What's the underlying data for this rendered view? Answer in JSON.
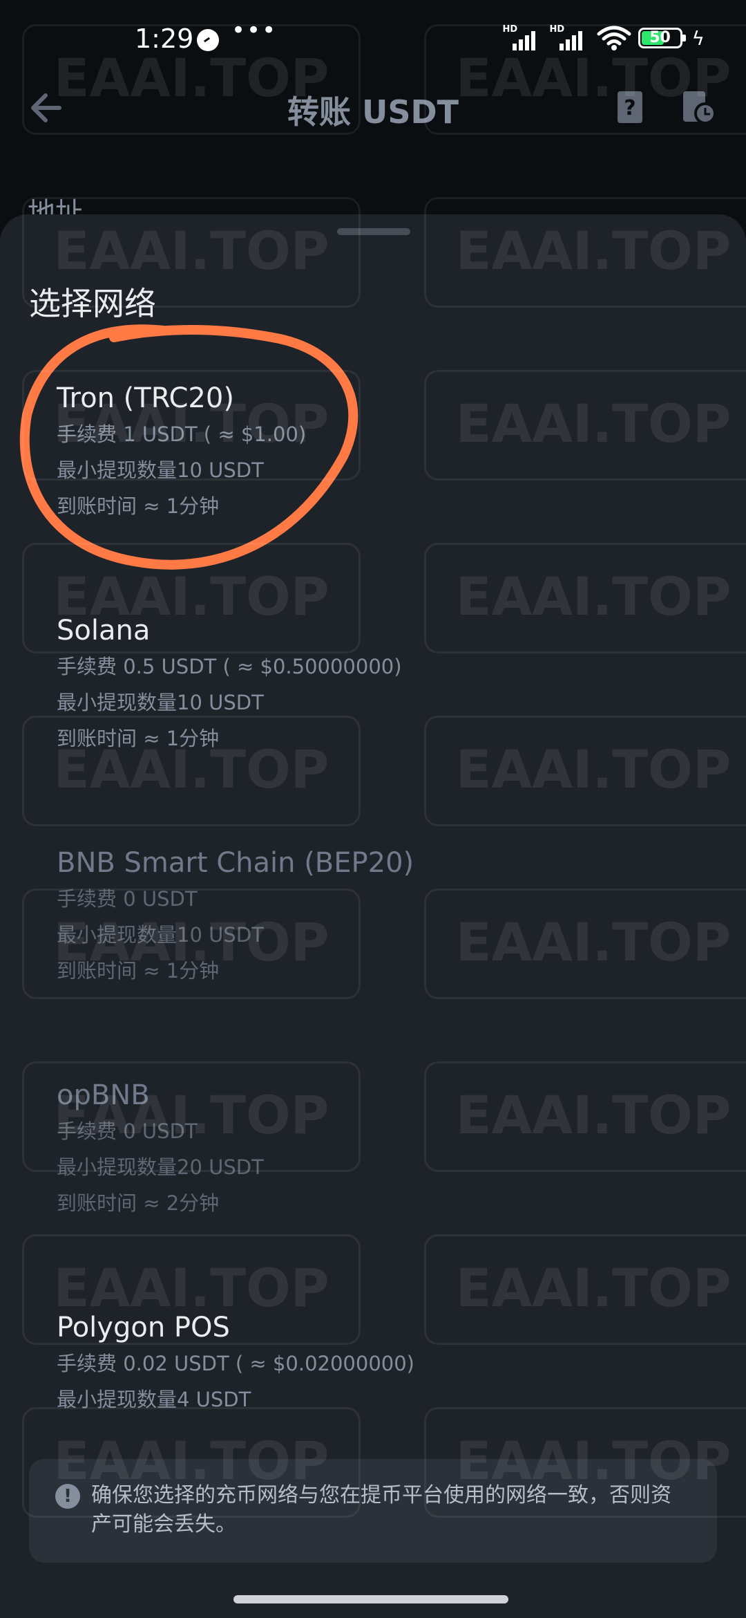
{
  "status_bar": {
    "time": "1:29",
    "dots": "•••",
    "signal_label": "HD",
    "battery": "50"
  },
  "header": {
    "title": "转账 USDT",
    "behind_label": "地址"
  },
  "sheet": {
    "title": "选择网络",
    "networks": [
      {
        "name": "Tron (TRC20)",
        "fee": "手续费 1 USDT ( ≈ $1.00)",
        "min": "最小提现数量10 USDT",
        "time": "到账时间 ≈ 1分钟",
        "enabled": true
      },
      {
        "name": "Solana",
        "fee": "手续费 0.5 USDT ( ≈ $0.50000000)",
        "min": "最小提现数量10 USDT",
        "time": "到账时间 ≈ 1分钟",
        "enabled": true
      },
      {
        "name": "BNB Smart Chain (BEP20)",
        "fee": "手续费 0 USDT",
        "min": "最小提现数量10 USDT",
        "time": "到账时间 ≈ 1分钟",
        "enabled": false
      },
      {
        "name": "opBNB",
        "fee": "手续费 0 USDT",
        "min": "最小提现数量20 USDT",
        "time": "到账时间 ≈ 2分钟",
        "enabled": false
      },
      {
        "name": "Polygon POS",
        "fee": "手续费 0.02 USDT ( ≈ $0.02000000)",
        "min": "最小提现数量4 USDT",
        "enabled": true
      }
    ],
    "warning": {
      "icon": "!",
      "text": "确保您选择的充币网络与您在提币平台使用的网络一致，否则资产可能会丢失。"
    }
  },
  "watermark_text": "EAAI.TOP",
  "colors": {
    "background": "#0b0e11",
    "sheet": "#1e2329",
    "annotation": "#ff7a45",
    "battery": "#2ee66b"
  },
  "icons": [
    "back-arrow-icon",
    "help-icon",
    "history-icon",
    "warning-icon",
    "wifi-icon",
    "signal-icon",
    "battery-icon",
    "clock-icon"
  ]
}
